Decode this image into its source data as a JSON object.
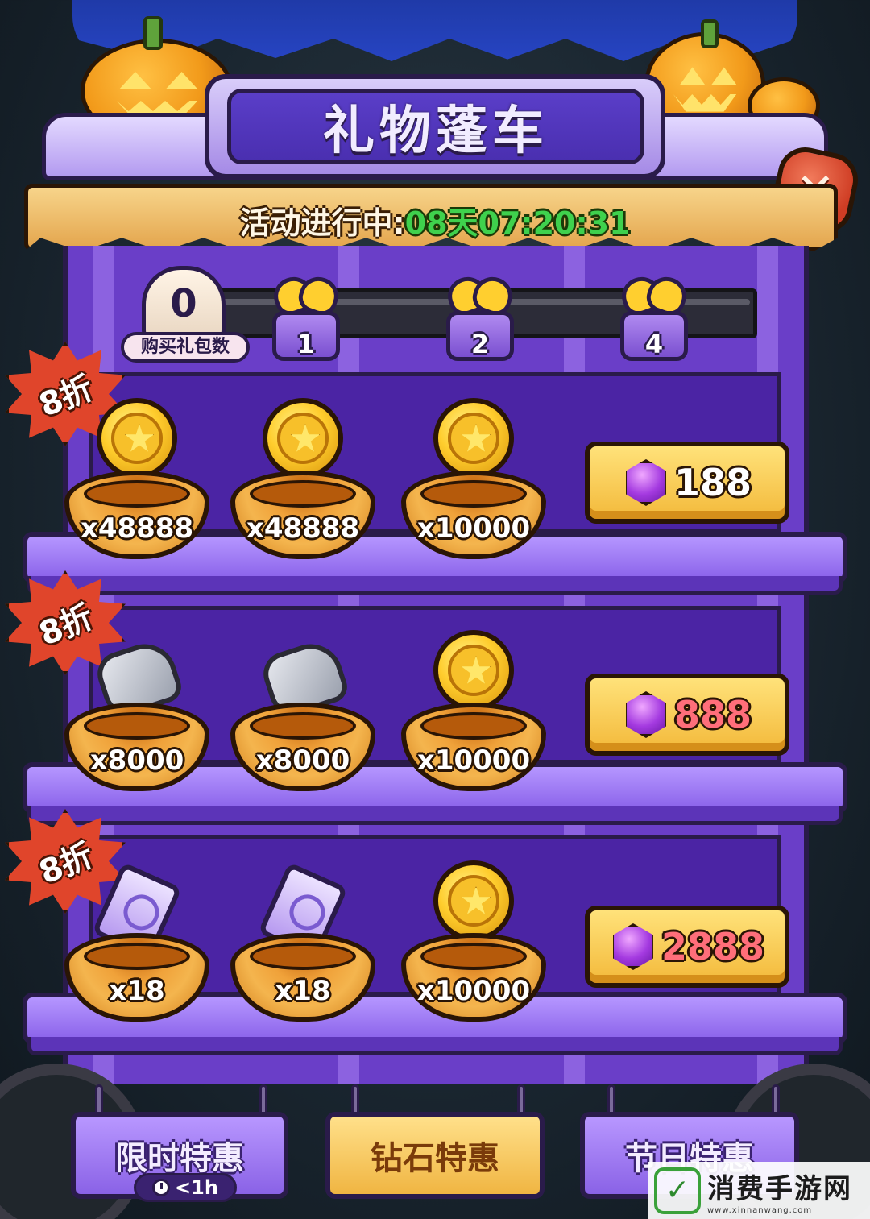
{
  "header": {
    "title": "礼物蓬车",
    "timer_label": "活动进行中:",
    "timer_value": "08天07:20:31"
  },
  "progress": {
    "count": "0",
    "count_label": "购买礼包数",
    "milestones": [
      "1",
      "2",
      "4"
    ]
  },
  "shelves": [
    {
      "discount": "8折",
      "items": [
        {
          "icon": "coin-icon",
          "qty": "x48888"
        },
        {
          "icon": "coin-icon",
          "qty": "x48888"
        },
        {
          "icon": "coin-icon",
          "qty": "x10000"
        }
      ],
      "price": "188"
    },
    {
      "discount": "8折",
      "items": [
        {
          "icon": "stone-icon",
          "qty": "x8000"
        },
        {
          "icon": "stone-icon",
          "qty": "x8000"
        },
        {
          "icon": "coin-icon",
          "qty": "x10000"
        }
      ],
      "price": "888"
    },
    {
      "discount": "8折",
      "items": [
        {
          "icon": "ticket-icon",
          "qty": "x18"
        },
        {
          "icon": "ticket-icon",
          "qty": "x18"
        },
        {
          "icon": "coin-icon",
          "qty": "x10000"
        }
      ],
      "price": "2888"
    }
  ],
  "tabs": [
    {
      "label": "限时特惠",
      "timer": "<1h"
    },
    {
      "label": "钻石特惠"
    },
    {
      "label": "节日特惠"
    }
  ],
  "watermark": {
    "name": "消费手游网",
    "url": "www.xinnanwang.com"
  },
  "colors": {
    "timer_green": "#3fd14d",
    "price_red": "#ff6e7a",
    "cabinet_purple": "#6a3ec8"
  }
}
